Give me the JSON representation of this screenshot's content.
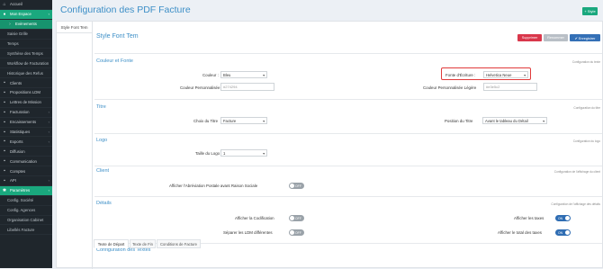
{
  "sidebar": {
    "items": [
      {
        "label": "Accueil",
        "icon": "home-icon",
        "glyph": "⌂",
        "kind": "top",
        "caret": ""
      },
      {
        "label": "Mon Espace",
        "icon": "user-icon",
        "glyph": "●",
        "kind": "green",
        "caret": "‹"
      },
      {
        "label": "Evènements",
        "icon": "chevron-icon",
        "glyph": "›",
        "kind": "sub-active",
        "caret": ""
      },
      {
        "label": "Saisie Grille",
        "icon": "",
        "glyph": "",
        "kind": "sub",
        "caret": ""
      },
      {
        "label": "Temps",
        "icon": "",
        "glyph": "",
        "kind": "sub",
        "caret": ""
      },
      {
        "label": "Synthèse des Temps",
        "icon": "",
        "glyph": "",
        "kind": "sub",
        "caret": ""
      },
      {
        "label": "Workflow de Facturation",
        "icon": "",
        "glyph": "",
        "kind": "sub",
        "caret": ""
      },
      {
        "label": "Historique des Refus",
        "icon": "",
        "glyph": "",
        "kind": "sub",
        "caret": ""
      },
      {
        "label": "Clients",
        "icon": "users-icon",
        "glyph": "▪",
        "kind": "top",
        "caret": ""
      },
      {
        "label": "Propositions LDM",
        "icon": "document-icon",
        "glyph": "▪",
        "kind": "top",
        "caret": ""
      },
      {
        "label": "Lettres de Mission",
        "icon": "document-icon",
        "glyph": "▪",
        "kind": "top",
        "caret": ""
      },
      {
        "label": "Facturation",
        "icon": "invoice-icon",
        "glyph": "▪",
        "kind": "top",
        "caret": "‹"
      },
      {
        "label": "Encaissements",
        "icon": "money-icon",
        "glyph": "▪",
        "kind": "top",
        "caret": "‹"
      },
      {
        "label": "Statistiques",
        "icon": "chart-icon",
        "glyph": "▪",
        "kind": "top",
        "caret": "‹"
      },
      {
        "label": "Exports",
        "icon": "export-icon",
        "glyph": "▪",
        "kind": "top",
        "caret": "‹"
      },
      {
        "label": "Diffusion",
        "icon": "broadcast-icon",
        "glyph": "▪",
        "kind": "top",
        "caret": ""
      },
      {
        "label": "Communication",
        "icon": "chat-icon",
        "glyph": "▪",
        "kind": "top",
        "caret": ""
      },
      {
        "label": "Comptes",
        "icon": "users-icon",
        "glyph": "▪",
        "kind": "top",
        "caret": ""
      },
      {
        "label": "API",
        "icon": "api-icon",
        "glyph": "▪",
        "kind": "top",
        "caret": "‹"
      },
      {
        "label": "Paramètres",
        "icon": "gear-icon",
        "glyph": "✱",
        "kind": "green",
        "caret": "‹"
      },
      {
        "label": "Config. Société",
        "icon": "",
        "glyph": "",
        "kind": "sub",
        "caret": ""
      },
      {
        "label": "Config. Agences",
        "icon": "",
        "glyph": "",
        "kind": "sub",
        "caret": ""
      },
      {
        "label": "Organisation Cabinet",
        "icon": "",
        "glyph": "",
        "kind": "sub",
        "caret": ""
      },
      {
        "label": "Libellés Facture",
        "icon": "",
        "glyph": "",
        "kind": "sub",
        "caret": ""
      }
    ]
  },
  "header": {
    "title": "Configuration des PDF Facture",
    "style_button": "+ Style"
  },
  "vertical_tab": "Style Font Tem",
  "form": {
    "title": "Style Font Tem",
    "delete_label": "Supprimer",
    "rename_label": "Renommer",
    "save_label": "✔ Enregistrer"
  },
  "sections": {
    "couleur": {
      "title": "Couleur et Fonte",
      "note": "Configuration du texte",
      "couleur_label": "Couleur :",
      "couleur_value": "Bleu",
      "fonte_label": "Fonte d'Écriture :",
      "fonte_value": "Helvetica Neue",
      "perso_label": "Couleur Personnalisée",
      "perso_value": "#274294",
      "perso_legere_label": "Couleur Personnalisée Légère",
      "perso_legere_value": "#e3e5c2"
    },
    "titre": {
      "title": "Titre",
      "note": "Configuration du titre",
      "choix_label": "Choix du Titre",
      "choix_value": "Facture",
      "position_label": "Position du Titre",
      "position_value": "Avant le tableau du Détail"
    },
    "logo": {
      "title": "Logo",
      "note": "Configuration du logo",
      "taille_label": "Taille du Logo",
      "taille_value": "1"
    },
    "client": {
      "title": "Client",
      "note": "Configuration de l'affichage du client",
      "abrev_label": "Afficher l'Abréviation Postale avant Raison Sociale",
      "abrev_toggle": "OFF"
    },
    "details": {
      "title": "Détails",
      "note": "Configuration de l'affichage des détails",
      "codif_label": "Afficher la Codification",
      "codif_toggle": "OFF",
      "taxes_label": "Afficher les taxes",
      "taxes_toggle": "ON",
      "separer_label": "Séparer les LDM différentes",
      "separer_toggle": "OFF",
      "total_label": "Afficher le total des taxes",
      "total_toggle": "ON"
    },
    "textes": {
      "title": "Configuration des Textes",
      "tabs": [
        "Texte de Départ",
        "Texte de Fin",
        "Conditions de Facture"
      ]
    }
  },
  "colors": {
    "accent": "#3d8fc7",
    "sidebar": "#1f262c",
    "green": "#1aa87e",
    "danger": "#d9374b",
    "primary": "#3470b6"
  }
}
